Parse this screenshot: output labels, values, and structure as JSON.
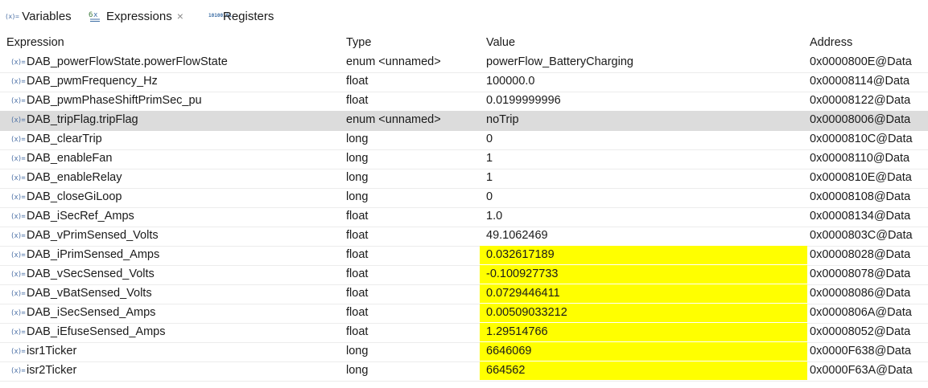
{
  "tabs": [
    {
      "label": "Variables",
      "icon": "variables-icon",
      "icon_text": "(x)="
    },
    {
      "label": "Expressions",
      "icon": "expressions-icon",
      "close": "×"
    },
    {
      "label": "Registers",
      "icon": "registers-icon",
      "icon_lines": [
        "1010",
        "0101"
      ]
    }
  ],
  "columns": {
    "expression": "Expression",
    "type": "Type",
    "value": "Value",
    "address": "Address"
  },
  "row_icon": "(x)=",
  "colors": {
    "highlight": "#ffff00",
    "selected_row": "#dcdcdc"
  },
  "rows": [
    {
      "expression": "DAB_powerFlowState.powerFlowState",
      "type": "enum <unnamed>",
      "value": "powerFlow_BatteryCharging",
      "address": "0x0000800E@Data",
      "highlighted": false,
      "selected": false
    },
    {
      "expression": "DAB_pwmFrequency_Hz",
      "type": "float",
      "value": "100000.0",
      "address": "0x00008114@Data",
      "highlighted": false,
      "selected": false
    },
    {
      "expression": "DAB_pwmPhaseShiftPrimSec_pu",
      "type": "float",
      "value": "0.0199999996",
      "address": "0x00008122@Data",
      "highlighted": false,
      "selected": false
    },
    {
      "expression": "DAB_tripFlag.tripFlag",
      "type": "enum <unnamed>",
      "value": "noTrip",
      "address": "0x00008006@Data",
      "highlighted": false,
      "selected": true
    },
    {
      "expression": "DAB_clearTrip",
      "type": "long",
      "value": "0",
      "address": "0x0000810C@Data",
      "highlighted": false,
      "selected": false
    },
    {
      "expression": "DAB_enableFan",
      "type": "long",
      "value": "1",
      "address": "0x00008110@Data",
      "highlighted": false,
      "selected": false
    },
    {
      "expression": "DAB_enableRelay",
      "type": "long",
      "value": "1",
      "address": "0x0000810E@Data",
      "highlighted": false,
      "selected": false
    },
    {
      "expression": "DAB_closeGiLoop",
      "type": "long",
      "value": "0",
      "address": "0x00008108@Data",
      "highlighted": false,
      "selected": false
    },
    {
      "expression": "DAB_iSecRef_Amps",
      "type": "float",
      "value": "1.0",
      "address": "0x00008134@Data",
      "highlighted": false,
      "selected": false
    },
    {
      "expression": "DAB_vPrimSensed_Volts",
      "type": "float",
      "value": "49.1062469",
      "address": "0x0000803C@Data",
      "highlighted": false,
      "selected": false
    },
    {
      "expression": "DAB_iPrimSensed_Amps",
      "type": "float",
      "value": "0.032617189",
      "address": "0x00008028@Data",
      "highlighted": true,
      "selected": false
    },
    {
      "expression": "DAB_vSecSensed_Volts",
      "type": "float",
      "value": "-0.100927733",
      "address": "0x00008078@Data",
      "highlighted": true,
      "selected": false
    },
    {
      "expression": "DAB_vBatSensed_Volts",
      "type": "float",
      "value": "0.0729446411",
      "address": "0x00008086@Data",
      "highlighted": true,
      "selected": false
    },
    {
      "expression": "DAB_iSecSensed_Amps",
      "type": "float",
      "value": "0.00509033212",
      "address": "0x0000806A@Data",
      "highlighted": true,
      "selected": false
    },
    {
      "expression": "DAB_iEfuseSensed_Amps",
      "type": "float",
      "value": "1.29514766",
      "address": "0x00008052@Data",
      "highlighted": true,
      "selected": false
    },
    {
      "expression": "isr1Ticker",
      "type": "long",
      "value": "6646069",
      "address": "0x0000F638@Data",
      "highlighted": true,
      "selected": false
    },
    {
      "expression": "isr2Ticker",
      "type": "long",
      "value": "664562",
      "address": "0x0000F63A@Data",
      "highlighted": true,
      "selected": false
    }
  ]
}
